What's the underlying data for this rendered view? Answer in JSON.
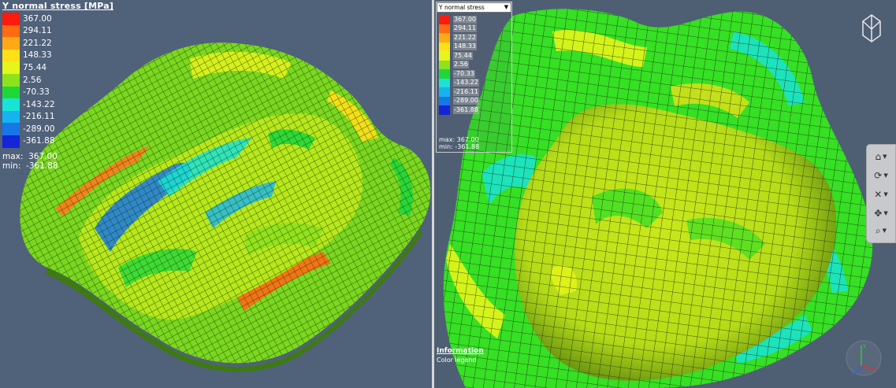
{
  "left_view": {
    "legend": {
      "title": "Y normal stress [MPa]",
      "entries": [
        {
          "label": "367.00",
          "color": "#ff1a0f"
        },
        {
          "label": "294.11",
          "color": "#ff6a12"
        },
        {
          "label": "221.22",
          "color": "#ffaa14"
        },
        {
          "label": "148.33",
          "color": "#ffe017"
        },
        {
          "label": "75.44",
          "color": "#e6f51a"
        },
        {
          "label": "2.56",
          "color": "#8ee21c"
        },
        {
          "label": "-70.33",
          "color": "#1fd838"
        },
        {
          "label": "-143.22",
          "color": "#19e3d6"
        },
        {
          "label": "-216.11",
          "color": "#15b4f0"
        },
        {
          "label": "-289.00",
          "color": "#1777e8"
        },
        {
          "label": "-361.88",
          "color": "#1424d9"
        }
      ],
      "max_label": "max:",
      "max_value": "367.00",
      "min_label": "min:",
      "min_value": "-361.88"
    }
  },
  "right_view": {
    "legend": {
      "dropdown_value": "Y normal stress",
      "entries": [
        {
          "label": "367.00",
          "color": "#ff1a0f"
        },
        {
          "label": "294.11",
          "color": "#ff6a12"
        },
        {
          "label": "221.22",
          "color": "#ffaa14"
        },
        {
          "label": "148.33",
          "color": "#ffe017"
        },
        {
          "label": "75.44",
          "color": "#e6f51a"
        },
        {
          "label": "2.56",
          "color": "#8ee21c"
        },
        {
          "label": "-70.33",
          "color": "#1fd838"
        },
        {
          "label": "-143.22",
          "color": "#19e3d6"
        },
        {
          "label": "-216.11",
          "color": "#15b4f0"
        },
        {
          "label": "-289.00",
          "color": "#1777e8"
        },
        {
          "label": "-361.88",
          "color": "#1424d9"
        }
      ],
      "max_text": "max:  367.00",
      "min_text": "min:  -361.88"
    },
    "info_panel": {
      "heading": "Information",
      "subtext": "Color legend"
    },
    "toolbar": [
      {
        "icon": "home-view-icon"
      },
      {
        "icon": "rotate-view-icon"
      },
      {
        "icon": "fit-view-icon"
      },
      {
        "icon": "pan-view-icon"
      },
      {
        "icon": "zoom-view-icon"
      }
    ],
    "axis_labels": {
      "y": "y",
      "z": "z",
      "x": "x"
    }
  }
}
